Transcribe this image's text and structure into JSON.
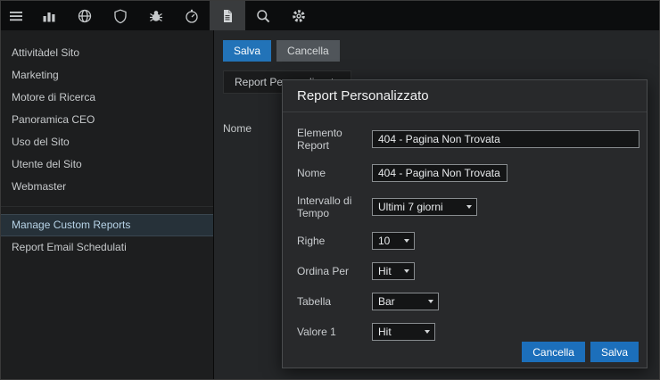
{
  "colors": {
    "accent_blue": "#2273b8",
    "modal_button_blue": "#1c6fbb",
    "selected_item_bg": "#263139"
  },
  "topbar": {
    "icons": [
      "menu-icon",
      "bar-chart-icon",
      "globe-icon",
      "shield-icon",
      "bug-icon",
      "timer-icon",
      "document-icon",
      "search-icon",
      "gear-icon"
    ],
    "active_icon": "document-icon"
  },
  "sidebar": {
    "items": [
      "Attivitàdel Sito",
      "Marketing",
      "Motore di Ricerca",
      "Panoramica CEO",
      "Uso del Sito",
      "Utente del Sito",
      "Webmaster",
      "Manage Custom Reports",
      "Report Email Schedulati"
    ],
    "selected_item": "Manage Custom Reports"
  },
  "main": {
    "save_button": "Salva",
    "cancel_button": "Cancella",
    "tab_label": "Report Personalizzato",
    "table_header": "Nome"
  },
  "modal": {
    "title": "Report Personalizzato",
    "fields": [
      {
        "label": "Elemento Report",
        "type": "text",
        "value": "404 - Pagina Non Trovata"
      },
      {
        "label": "Nome",
        "type": "text",
        "value": "404 - Pagina Non Trovata"
      },
      {
        "label": "Intervallo di Tempo",
        "type": "select",
        "value": "Ultimi 7 giorni"
      },
      {
        "label": "Righe",
        "type": "select",
        "value": "10"
      },
      {
        "label": "Ordina Per",
        "type": "select",
        "value": "Hit"
      },
      {
        "label": "Tabella",
        "type": "select",
        "value": "Bar"
      },
      {
        "label": "Valore 1",
        "type": "select",
        "value": "Hit"
      }
    ],
    "cancel_button": "Cancella",
    "save_button": "Salva"
  }
}
